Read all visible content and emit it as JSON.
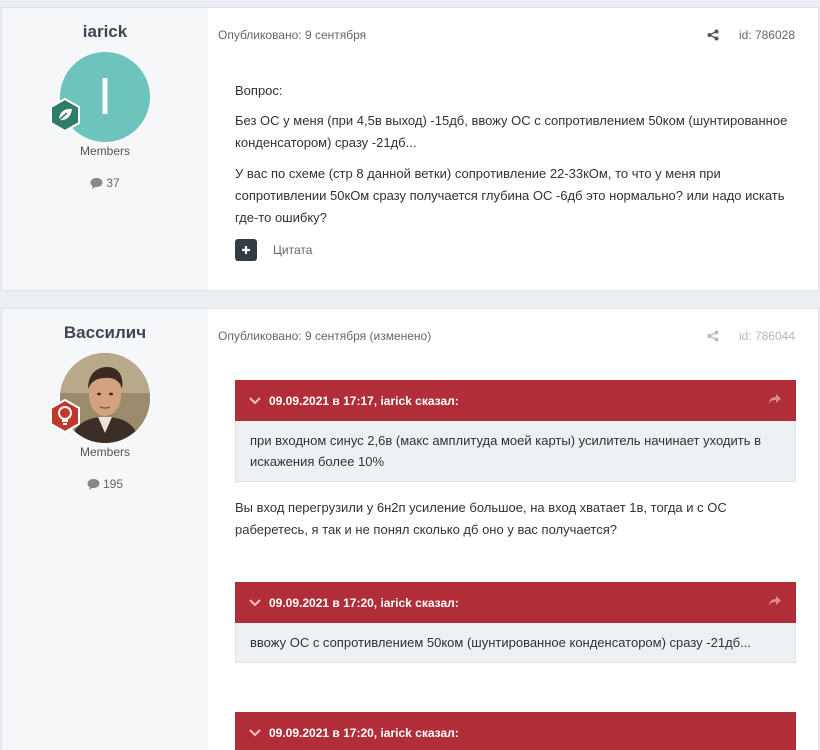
{
  "posts": [
    {
      "author": "iarick",
      "avatar_letter": "I",
      "group": "Members",
      "post_count": "37",
      "published": "Опубликовано: 9 сентября",
      "id": "id: 786028",
      "paragraphs": [
        "Вопрос:",
        "Без ОС у меня (при 4,5в выход) -15дб, ввожу ОС с сопротивлением 50ком (шунтированное конденсатором) сразу -21дб...",
        "У вас по схеме (стр 8 данной ветки) сопротивление 22-33кОм, то что у меня при сопротивлении 50кОм сразу получается глубина ОС -6дб это нормально? или надо искать где-то ошибку?"
      ],
      "quote_label": "Цитата"
    },
    {
      "author": "Вассилич",
      "group": "Members",
      "post_count": "195",
      "published": "Опубликовано: 9 сентября (изменено)",
      "id": "id: 786044",
      "quotes": [
        {
          "header": "09.09.2021 в 17:17, iarick сказал:",
          "body": "при входном синус 2,6в (макс амплитуда моей карты) усилитель начинает уходить в искажения более 10%"
        },
        {
          "header": "09.09.2021 в 17:20, iarick сказал:",
          "body": "ввожу ОС с сопротивлением 50ком (шунтированное конденсатором) сразу -21дб..."
        },
        {
          "header": "09.09.2021 в 17:20, iarick сказал:"
        }
      ],
      "reply": "Вы вход перегрузили у 6н2п усиление большое, на вход хватает 1в, тогда и с ОС раберетесь, я так и не понял сколько дб оно у вас получается?"
    }
  ],
  "icons": {
    "share": "share-icon",
    "comment": "comment-icon",
    "badge1": "leaf-badge-icon",
    "badge2": "lightbulb-badge-icon"
  },
  "colors": {
    "quote_header": "#b12e38",
    "avatar_bg": "#6cc4bd",
    "badge1": "#2e7d67",
    "badge2": "#c0392b"
  }
}
